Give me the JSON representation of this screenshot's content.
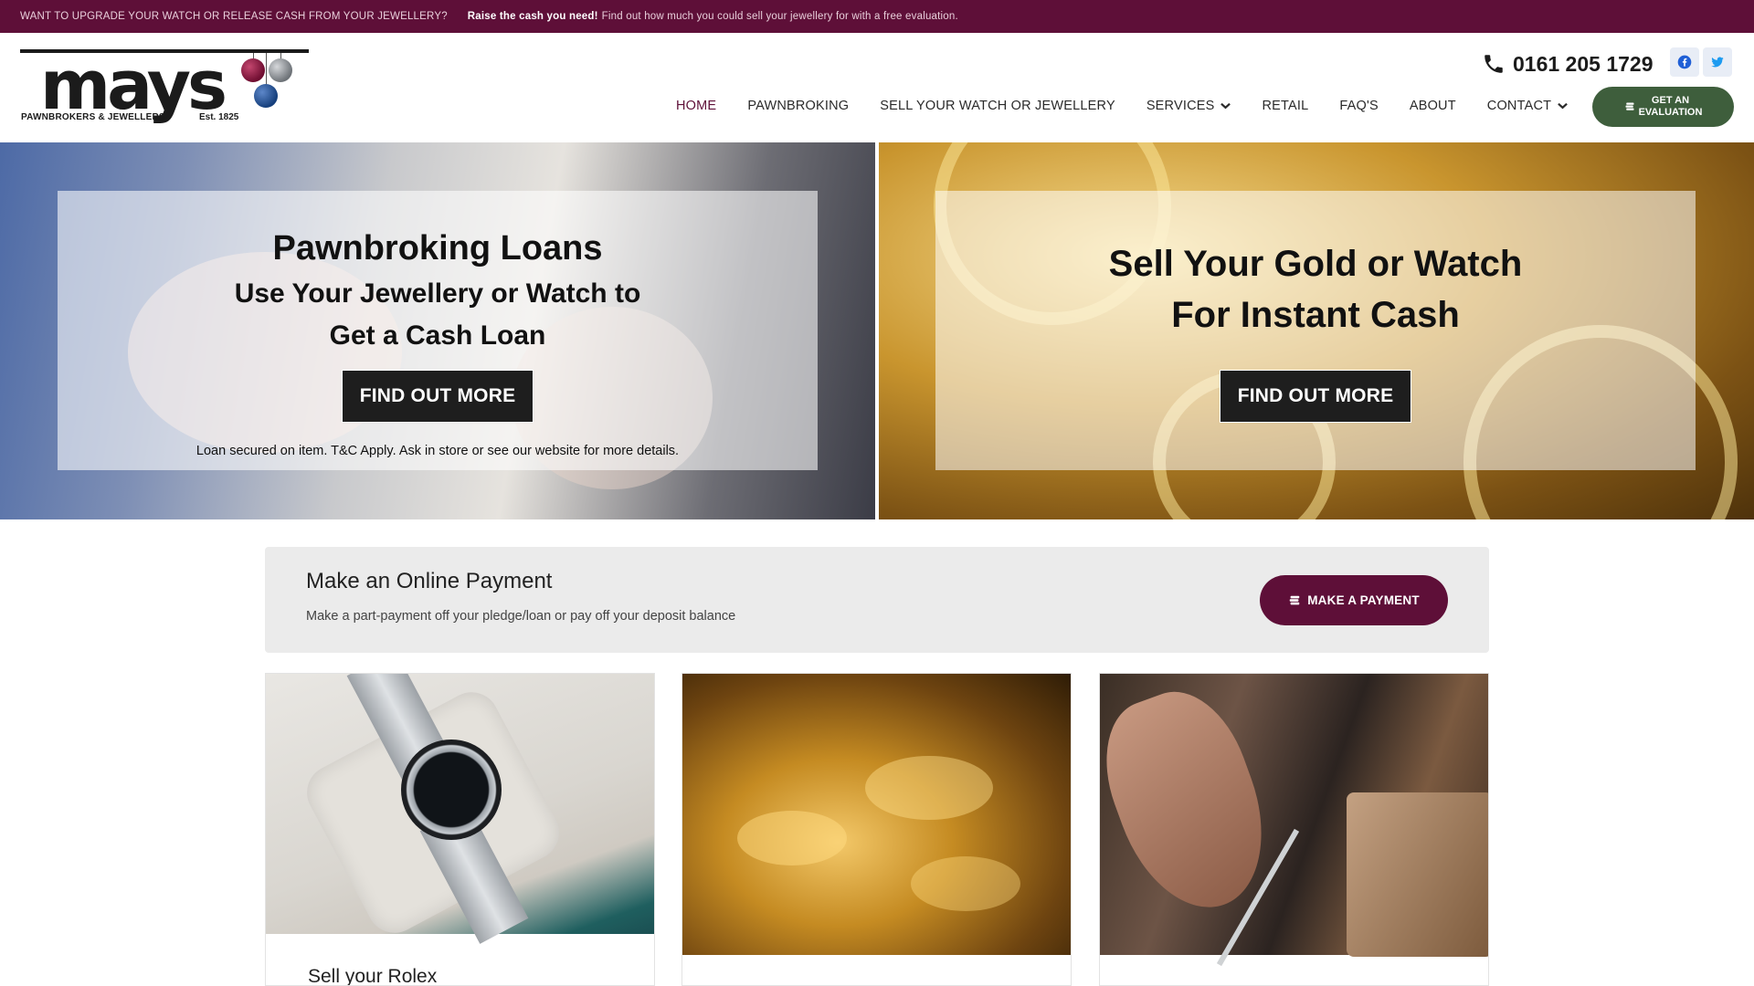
{
  "topbar": {
    "question": "WANT TO UPGRADE YOUR WATCH OR RELEASE CASH FROM YOUR JEWELLERY?",
    "highlight": "Raise the cash you need!",
    "text": "Find out how much you could sell your jewellery for with a free evaluation."
  },
  "brand": {
    "name": "mays",
    "tagline": "PAWNBROKERS & JEWELLERS",
    "established": "Est. 1825",
    "colors": {
      "primary": "#5e0f38",
      "evaluation": "#3e5e3c"
    }
  },
  "contact": {
    "phone": "0161 205 1729",
    "phone_icon": "phone-icon",
    "social": [
      {
        "name": "facebook",
        "icon": "facebook-icon"
      },
      {
        "name": "twitter",
        "icon": "twitter-icon"
      }
    ]
  },
  "nav": {
    "items": [
      {
        "label": "HOME",
        "active": true
      },
      {
        "label": "PAWNBROKING"
      },
      {
        "label": "SELL YOUR WATCH OR JEWELLERY"
      },
      {
        "label": "SERVICES",
        "dropdown": true
      },
      {
        "label": "RETAIL"
      },
      {
        "label": "FAQ'S"
      },
      {
        "label": "ABOUT"
      },
      {
        "label": "CONTACT",
        "dropdown": true
      }
    ],
    "cta_line1": "GET AN",
    "cta_line2": "EVALUATION"
  },
  "heroes": {
    "left": {
      "title": "Pawnbroking Loans",
      "line1": "Use Your Jewellery or Watch to",
      "line2": "Get a Cash Loan",
      "button": "FIND OUT MORE",
      "disclaimer": "Loan secured on item. T&C Apply. Ask in store or see our website for more details."
    },
    "right": {
      "line1": "Sell Your Gold or Watch",
      "line2": "For Instant Cash",
      "button": "FIND OUT MORE"
    }
  },
  "payment": {
    "title": "Make an Online Payment",
    "description": "Make a part-payment off your pledge/loan or pay off your deposit balance",
    "button": "MAKE A PAYMENT"
  },
  "cards": [
    {
      "title": "Sell your Rolex",
      "image": "rolex-watch-image"
    },
    {
      "title": "",
      "image": "gold-chains-image"
    },
    {
      "title": "",
      "image": "jeweller-working-image"
    }
  ]
}
